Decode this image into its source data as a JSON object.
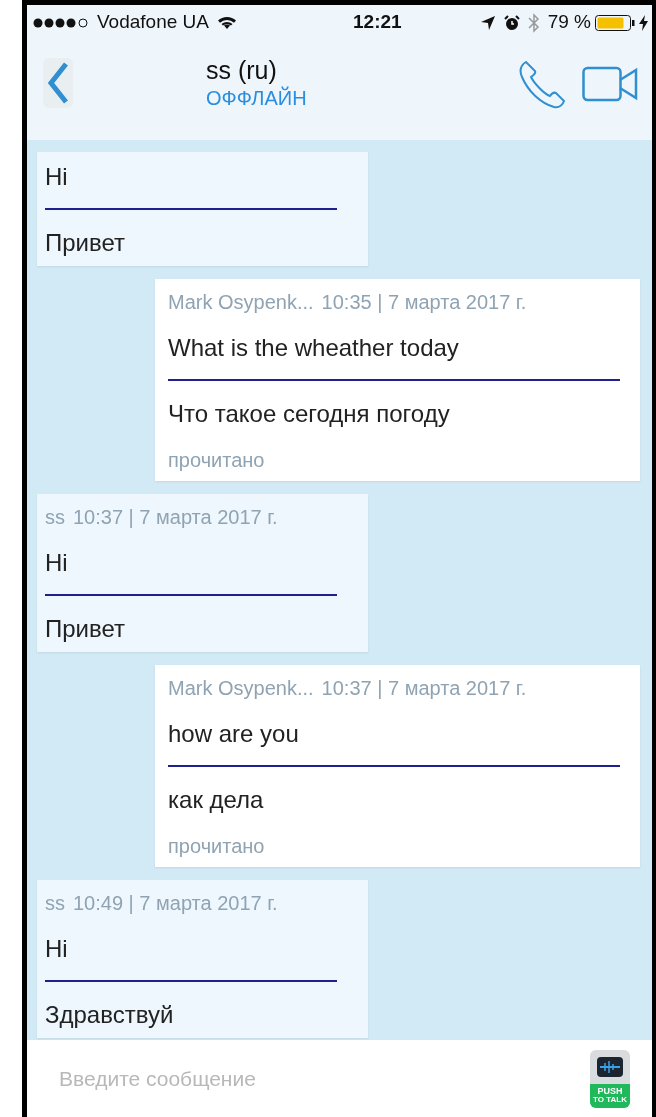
{
  "status_bar": {
    "carrier": "Vodafone UA",
    "time": "12:21",
    "battery": "79 %"
  },
  "header": {
    "title": "ss (ru)",
    "presence": "ОФФЛАЙН"
  },
  "messages": [
    {
      "kind": "incoming",
      "text": "Hi",
      "translation": "Привет"
    },
    {
      "kind": "outgoing",
      "sender": "Mark Osypenk...",
      "time": "10:35 | 7 марта 2017 г.",
      "text": "What is the wheather today",
      "translation": "Что такое сегодня погоду",
      "status": "прочитано"
    },
    {
      "kind": "incoming",
      "sender": "ss",
      "time": "10:37 | 7 марта 2017 г.",
      "text": "Hi",
      "translation": "Привет"
    },
    {
      "kind": "outgoing",
      "sender": "Mark Osypenk...",
      "time": "10:37 | 7 марта 2017 г.",
      "text": "how are you",
      "translation": "как дела",
      "status": "прочитано"
    },
    {
      "kind": "incoming",
      "sender": "ss",
      "time": "10:49 | 7 марта 2017 г.",
      "text": "Hi",
      "translation": "Здравствуй"
    }
  ],
  "composer": {
    "placeholder": "Введите сообщение",
    "push_to_talk": [
      "PUSH",
      "TO TALK"
    ]
  }
}
